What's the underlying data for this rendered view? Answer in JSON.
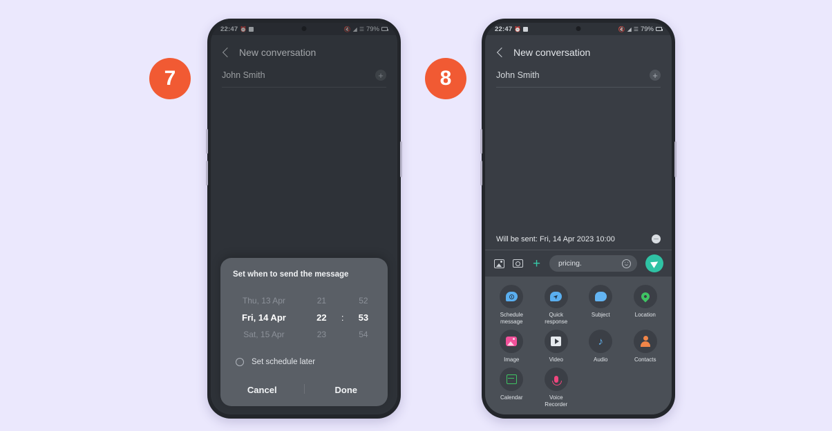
{
  "page": {
    "background_color": "#ebe8fd",
    "accent_color": "#f15a33",
    "send_color": "#2fc2a4"
  },
  "steps": [
    {
      "number": "7"
    },
    {
      "number": "8"
    }
  ],
  "status_bar": {
    "time": "22:47",
    "battery": "79%",
    "icons": [
      "alarm-icon",
      "check-square-icon",
      "mute-icon",
      "wifi-icon",
      "signal-icon"
    ]
  },
  "phone_left": {
    "header": {
      "title": "New conversation",
      "back_icon": "back-chevron-icon"
    },
    "recipient": {
      "name": "John Smith",
      "add_icon": "add-contact-icon"
    },
    "dialog": {
      "title": "Set when to send the message",
      "picker": {
        "rows": [
          {
            "date": "Thu, 13 Apr",
            "hour": "21",
            "sep": ":",
            "minute": "52",
            "selected": false
          },
          {
            "date": "Fri, 14 Apr",
            "hour": "22",
            "sep": ":",
            "minute": "53",
            "selected": true
          },
          {
            "date": "Sat, 15 Apr",
            "hour": "23",
            "sep": ":",
            "minute": "54",
            "selected": false
          }
        ]
      },
      "set_later_label": "Set schedule later",
      "cancel_label": "Cancel",
      "done_label": "Done"
    }
  },
  "phone_right": {
    "header": {
      "title": "New conversation",
      "back_icon": "back-chevron-icon"
    },
    "recipient": {
      "name": "John Smith",
      "add_icon": "add-contact-icon"
    },
    "schedule_banner": {
      "text": "Will be sent: Fri, 14 Apr 2023 10:00",
      "dismiss_icon": "remove-schedule-icon"
    },
    "compose": {
      "gallery_icon": "gallery-icon",
      "camera_icon": "camera-icon",
      "plus_icon": "plus-icon",
      "message_value": "pricing.",
      "emoji_icon": "emoji-icon",
      "send_icon": "send-icon"
    },
    "attachment_sheet": {
      "tiles": [
        {
          "label": "Schedule message",
          "icon": "schedule-message-icon"
        },
        {
          "label": "Quick response",
          "icon": "quick-response-icon"
        },
        {
          "label": "Subject",
          "icon": "subject-icon"
        },
        {
          "label": "Location",
          "icon": "location-icon"
        },
        {
          "label": "Image",
          "icon": "image-icon"
        },
        {
          "label": "Video",
          "icon": "video-icon"
        },
        {
          "label": "Audio",
          "icon": "audio-icon"
        },
        {
          "label": "Contacts",
          "icon": "contacts-icon"
        },
        {
          "label": "Calendar",
          "icon": "calendar-icon"
        },
        {
          "label": "Voice Recorder",
          "icon": "voice-recorder-icon"
        }
      ]
    }
  }
}
